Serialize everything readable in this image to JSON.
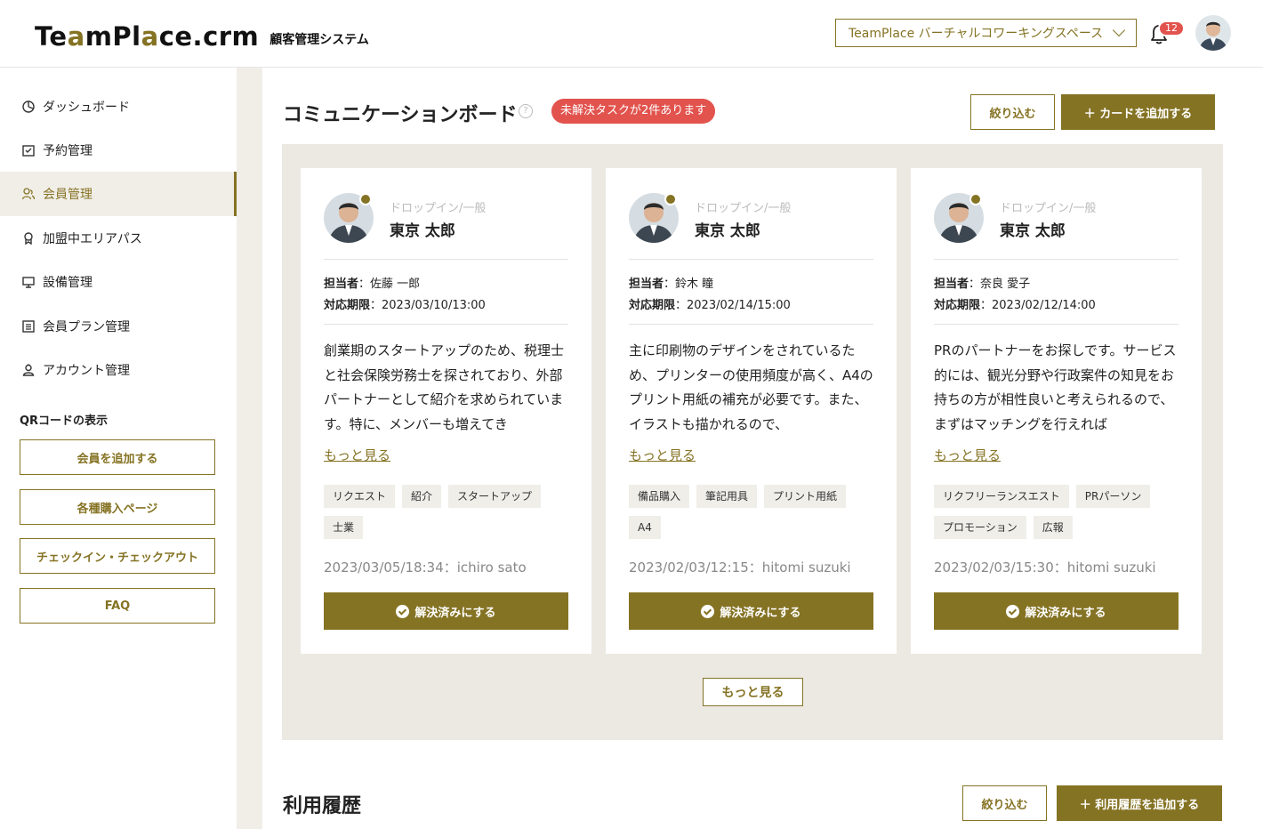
{
  "header": {
    "logo_part1": "Te",
    "logo_o1": "a",
    "logo_part2": "mPl",
    "logo_o2": "a",
    "logo_part3": "ce.crm",
    "logo_sub": "顧客管理システム",
    "workspace": "TeamPlace バーチャルコワーキングスペース",
    "notification_count": "12"
  },
  "sidebar": {
    "items": [
      {
        "label": "ダッシュボード",
        "icon": "dashboard-icon"
      },
      {
        "label": "予約管理",
        "icon": "calendar-icon"
      },
      {
        "label": "会員管理",
        "icon": "members-icon"
      },
      {
        "label": "加盟中エリアパス",
        "icon": "pin-icon"
      },
      {
        "label": "設備管理",
        "icon": "monitor-icon"
      },
      {
        "label": "会員プラン管理",
        "icon": "list-icon"
      },
      {
        "label": "アカウント管理",
        "icon": "account-icon"
      }
    ],
    "active_index": 2,
    "qr_title": "QRコードの表示",
    "buttons": [
      "会員を追加する",
      "各種購入ページ",
      "チェックイン・チェックアウト",
      "FAQ"
    ]
  },
  "board": {
    "title": "コミュニケーションボード",
    "help": "?",
    "alert": "未解決タスクが2件あります",
    "filter_label": "絞り込む",
    "add_label": "＋ カードを追加する",
    "more_label": "もっと見る",
    "cards": [
      {
        "category": "ドロップイン/一般",
        "name": "東京 太郎",
        "assignee_label": "担当者",
        "assignee": "：佐藤 一郎",
        "deadline_label": "対応期限",
        "deadline": "：2023/03/10/13:00",
        "description": "創業期のスタートアップのため、税理士と社会保険労務士を探されており、外部パートナーとして紹介を求められています。特に、メンバーも増えてき",
        "more": "もっと見る",
        "tags": [
          "リクエスト",
          "紹介",
          "スタートアップ",
          "士業"
        ],
        "timestamp": "2023/03/05/18:34：ichiro sato",
        "resolve": "解決済みにする"
      },
      {
        "category": "ドロップイン/一般",
        "name": "東京 太郎",
        "assignee_label": "担当者",
        "assignee": "：鈴木 瞳",
        "deadline_label": "対応期限",
        "deadline": "：2023/02/14/15:00",
        "description": "主に印刷物のデザインをされているため、プリンターの使用頻度が高く、A4のプリント用紙の補充が必要です。また、イラストも描かれるので、",
        "more": "もっと見る",
        "tags": [
          "備品購入",
          "筆記用具",
          "プリント用紙",
          "A4"
        ],
        "timestamp": "2023/02/03/12:15：hitomi suzuki",
        "resolve": "解決済みにする"
      },
      {
        "category": "ドロップイン/一般",
        "name": "東京 太郎",
        "assignee_label": "担当者",
        "assignee": "：奈良 愛子",
        "deadline_label": "対応期限",
        "deadline": "：2023/02/12/14:00",
        "description": "PRのパートナーをお探しです。サービス的には、観光分野や行政案件の知見をお持ちの方が相性良いと考えられるので、まずはマッチングを行えれば",
        "more": "もっと見る",
        "tags": [
          "リクフリーランスエスト",
          "PRパーソン",
          "プロモーション",
          "広報"
        ],
        "timestamp": "2023/02/03/15:30：hitomi suzuki",
        "resolve": "解決済みにする"
      }
    ]
  },
  "history": {
    "title": "利用履歴",
    "filter_label": "絞り込む",
    "add_label": "＋ 利用履歴を追加する"
  },
  "colors": {
    "accent": "#857324",
    "alert": "#e2534e",
    "board_bg": "#ece9e3"
  }
}
